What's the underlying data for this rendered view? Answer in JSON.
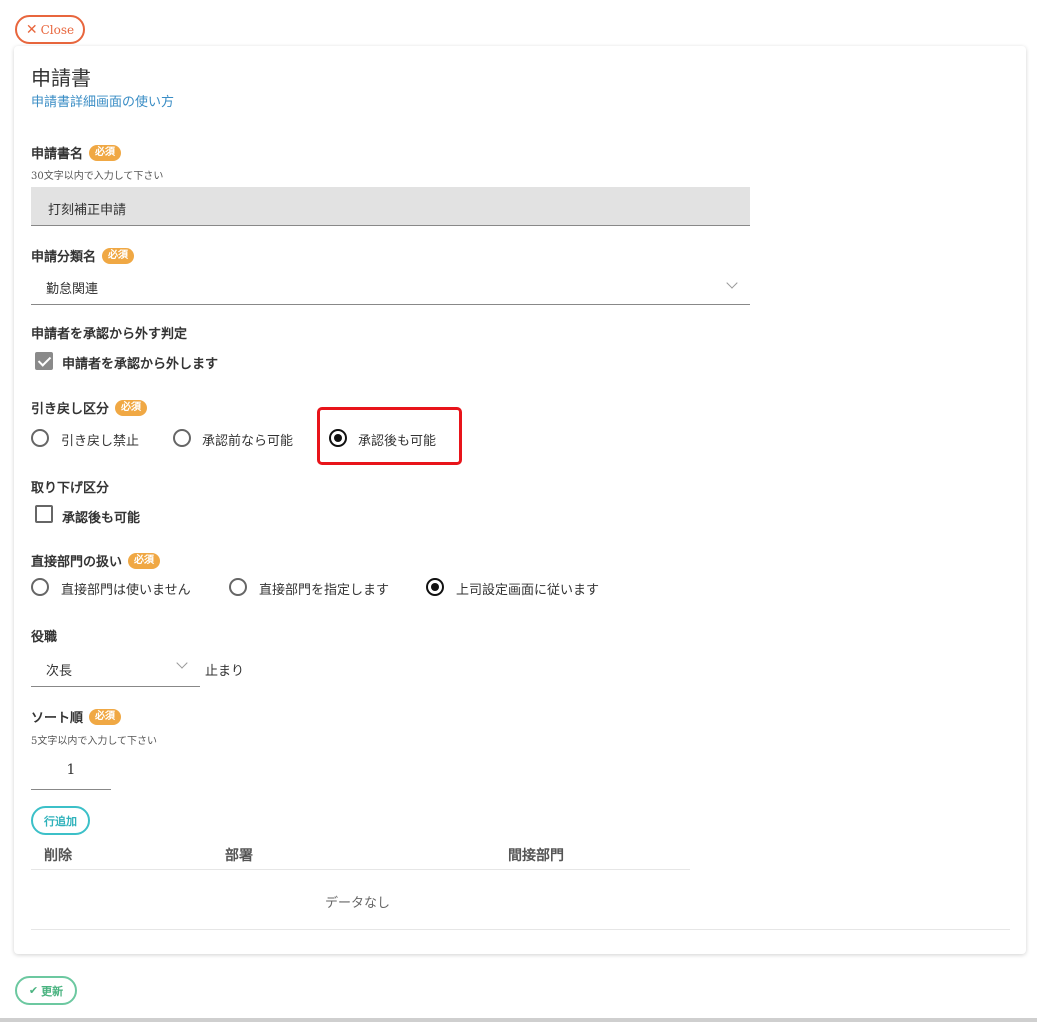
{
  "close_label": "Close",
  "header": {
    "title": "申請書",
    "help_link": "申請書詳細画面の使い方"
  },
  "required_badge": "必須",
  "form_name": {
    "label": "申請書名",
    "hint": "30文字以内で入力して下さい",
    "value": "打刻補正申請"
  },
  "category": {
    "label": "申請分類名",
    "value": "勤怠関連"
  },
  "exclude_applicant": {
    "label": "申請者を承認から外す判定",
    "checkbox_label": "申請者を承認から外します",
    "checked": true
  },
  "withdraw": {
    "label": "引き戻し区分",
    "options": [
      "引き戻し禁止",
      "承認前なら可能",
      "承認後も可能"
    ],
    "selected": "承認後も可能"
  },
  "retract": {
    "label": "取り下げ区分",
    "checkbox_label": "承認後も可能",
    "checked": false
  },
  "direct_dept": {
    "label": "直接部門の扱い",
    "options": [
      "直接部門は使いません",
      "直接部門を指定します",
      "上司設定画面に従います"
    ],
    "selected": "上司設定画面に従います"
  },
  "position": {
    "label": "役職",
    "value": "次長",
    "suffix": "止まり"
  },
  "sort_order": {
    "label": "ソート順",
    "hint": "5文字以内で入力して下さい",
    "value": "1"
  },
  "table": {
    "add_row_label": "行追加",
    "headers": [
      "削除",
      "部署",
      "間接部門"
    ],
    "empty_text": "データなし"
  },
  "update_label": "更新",
  "colors": {
    "close": "#e8663d",
    "required": "#f0a844",
    "link": "#3a8dc5",
    "add_row": "#3cc0c8",
    "update": "#6cc8a0",
    "highlight": "#e8141a"
  }
}
